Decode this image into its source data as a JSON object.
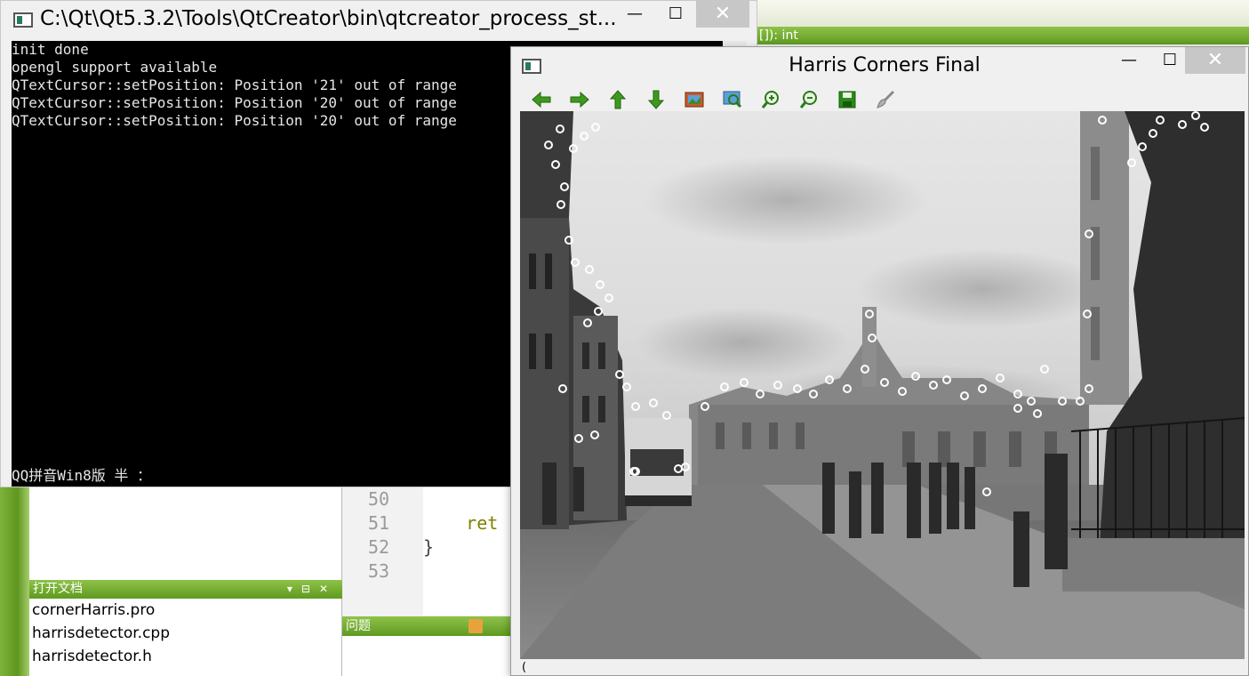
{
  "qtcreator": {
    "greenbar_text": "[]): int",
    "code_lines": [
      {
        "num": "50",
        "text": ""
      },
      {
        "num": "51",
        "text": "    ret"
      },
      {
        "num": "52",
        "text": "}"
      },
      {
        "num": "53",
        "text": ""
      }
    ],
    "open_docs": {
      "title": "打开文档",
      "files": [
        "cornerHarris.pro",
        "harrisdetector.cpp",
        "harrisdetector.h"
      ]
    },
    "issues_title": "问题"
  },
  "console": {
    "title": "C:\\Qt\\Qt5.3.2\\Tools\\QtCreator\\bin\\qtcreator_process_st...",
    "lines": [
      "init done",
      "opengl support available",
      "QTextCursor::setPosition: Position '21' out of range",
      "QTextCursor::setPosition: Position '20' out of range",
      "QTextCursor::setPosition: Position '20' out of range"
    ],
    "ime_status": "QQ拼音Win8版 半 ："
  },
  "harris": {
    "title": "Harris Corners Final",
    "status": "("
  },
  "colors": {
    "qt_green": "#6aa82a",
    "console_bg": "#000000",
    "console_fg": "#e6e6e6",
    "close_bg": "#c7c7c7"
  }
}
